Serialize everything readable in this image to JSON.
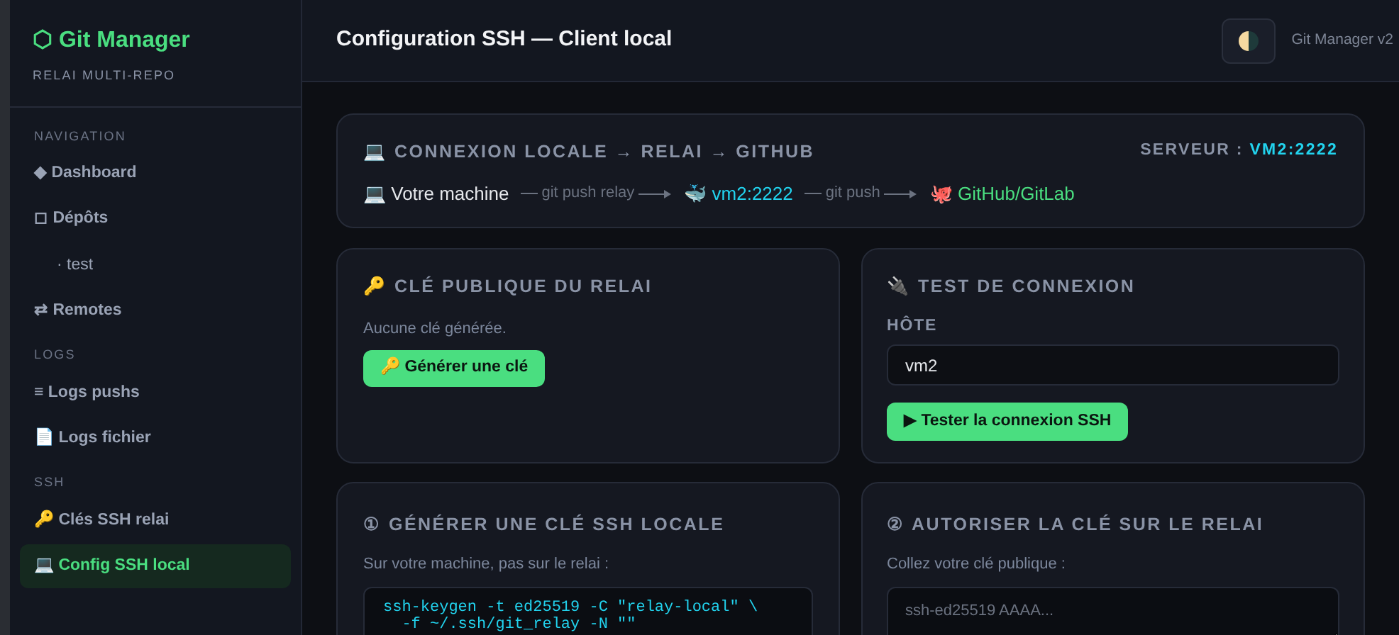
{
  "sidebar": {
    "brand": "⬡ Git Manager",
    "subtitle": "RELAI MULTI-REPO",
    "sections": [
      {
        "title": "NAVIGATION",
        "items": [
          {
            "label": "◆ Dashboard",
            "selected": false,
            "sub": false
          },
          {
            "label": "◻ Dépôts",
            "selected": false,
            "sub": false
          },
          {
            "label": "· test",
            "selected": false,
            "sub": true
          },
          {
            "label": "⇄ Remotes",
            "selected": false,
            "sub": false
          }
        ]
      },
      {
        "title": "LOGS",
        "items": [
          {
            "label": "≡ Logs pushs",
            "selected": false,
            "sub": false
          },
          {
            "label": "📄 Logs fichier",
            "selected": false,
            "sub": false
          }
        ]
      },
      {
        "title": "SSH",
        "items": [
          {
            "label": "🔑 Clés SSH relai",
            "selected": false,
            "sub": false
          },
          {
            "label": "💻 Config SSH local",
            "selected": true,
            "sub": false
          }
        ]
      }
    ]
  },
  "header": {
    "title": "Configuration SSH — Client local",
    "version": "Git Manager v2"
  },
  "flow_card": {
    "title": "💻 CONNEXION LOCALE → RELAI → GITHUB",
    "server_label": "SERVEUR :",
    "server_value": "VM2:2222",
    "nodes": [
      {
        "label": "💻 Votre machine",
        "kind": "local"
      },
      {
        "label": "git push relay",
        "kind": "edge"
      },
      {
        "label": "🐳 vm2:2222",
        "kind": "relay"
      },
      {
        "label": "git push",
        "kind": "edge"
      },
      {
        "label": "🐙 GitHub/GitLab",
        "kind": "remote"
      }
    ]
  },
  "public_key_card": {
    "title": "🔑 CLÉ PUBLIQUE DU RELAI",
    "status": "Aucune clé générée.",
    "button": "🔑 Générer une clé"
  },
  "test_card": {
    "title": "🔌 TEST DE CONNEXION",
    "host_label": "HÔTE",
    "host_value": "vm2",
    "button": "▶ Tester la connexion SSH"
  },
  "generate_card": {
    "title": "① GÉNÉRER UNE CLÉ SSH LOCALE",
    "hint": "Sur votre machine, pas sur le relai :",
    "code": "ssh-keygen -t ed25519 -C \"relay-local\" \\\n  -f ~/.ssh/git_relay -N \"\""
  },
  "authorize_card": {
    "title": "② AUTORISER LA CLÉ SUR LE RELAI",
    "hint": "Collez votre clé publique :",
    "placeholder": "ssh-ed25519 AAAA..."
  }
}
